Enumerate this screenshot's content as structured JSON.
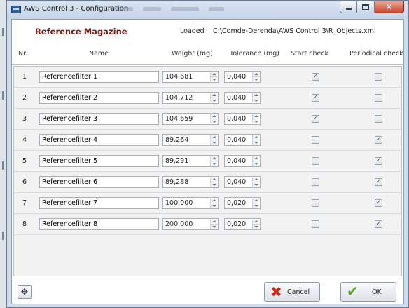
{
  "window": {
    "title": "AWS Control 3 - Configuration",
    "controls": {
      "minimize": "minimize-icon",
      "maximize": "maximize-icon",
      "close": "close-icon"
    }
  },
  "header": {
    "title": "Reference Magazine",
    "loaded_label": "Loaded",
    "loaded_path": "C:\\Comde-Derenda\\AWS Control 3\\R_Objects.xml"
  },
  "columns": {
    "nr": "Nr.",
    "name": "Name",
    "weight": "Weight (mg)",
    "tolerance": "Tolerance (mg)",
    "start_check": "Start check",
    "periodical_check": "Periodical check"
  },
  "rows": [
    {
      "nr": "1",
      "name": "Referencefilter 1",
      "weight": "104,681",
      "tolerance": "0,040",
      "start_check": true,
      "periodical_check": false
    },
    {
      "nr": "2",
      "name": "Referencefilter 2",
      "weight": "104,712",
      "tolerance": "0,040",
      "start_check": true,
      "periodical_check": false
    },
    {
      "nr": "3",
      "name": "Referencefilter 3",
      "weight": "104,659",
      "tolerance": "0,040",
      "start_check": true,
      "periodical_check": false
    },
    {
      "nr": "4",
      "name": "Referencefilter 4",
      "weight": "89,264",
      "tolerance": "0,040",
      "start_check": false,
      "periodical_check": true
    },
    {
      "nr": "5",
      "name": "Referencefilter 5",
      "weight": "89,291",
      "tolerance": "0,040",
      "start_check": false,
      "periodical_check": true
    },
    {
      "nr": "6",
      "name": "Referencefilter 6",
      "weight": "89,288",
      "tolerance": "0,040",
      "start_check": false,
      "periodical_check": true
    },
    {
      "nr": "7",
      "name": "Referencefilter 7",
      "weight": "100,000",
      "tolerance": "0,020",
      "start_check": false,
      "periodical_check": true
    },
    {
      "nr": "8",
      "name": "Referencefilter 8",
      "weight": "200,000",
      "tolerance": "0,020",
      "start_check": false,
      "periodical_check": true
    }
  ],
  "buttons": {
    "cancel": "Cancel",
    "ok": "OK",
    "move_icon": "move-icon"
  },
  "colors": {
    "title_accent": "#7a1b1b",
    "cancel_icon": "#cc2a1a",
    "ok_icon": "#5aa52a"
  }
}
